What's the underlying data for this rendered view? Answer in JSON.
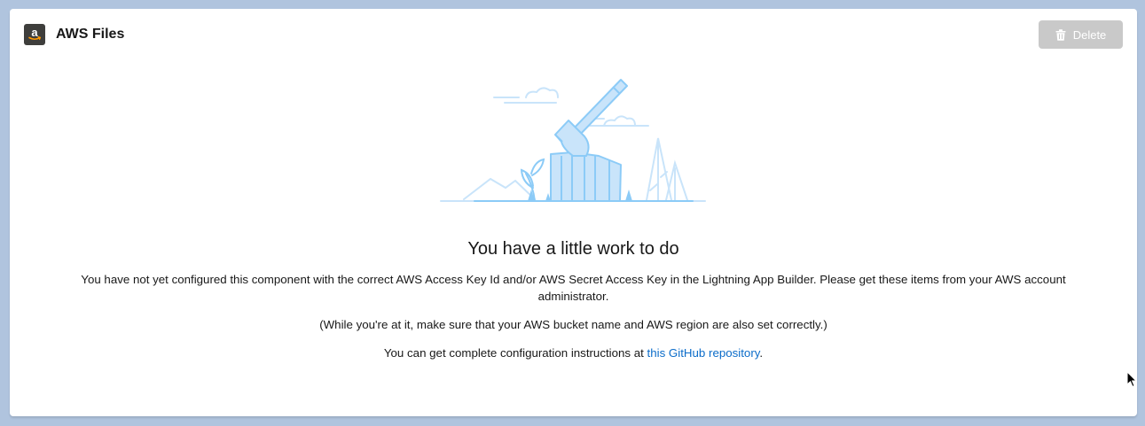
{
  "header": {
    "title": "AWS Files",
    "app_icon": "amazon-logo-icon",
    "delete_label": "Delete",
    "delete_icon": "trash-icon"
  },
  "empty_state": {
    "illustration": "axe-in-stump-illustration",
    "title": "You have a little work to do",
    "message1": "You have not yet configured this component with the correct AWS Access Key Id and/or AWS Secret Access Key in the Lightning App Builder. Please get these items from your AWS account administrator.",
    "message2": "(While you're at it, make sure that your AWS bucket name and AWS region are also set correctly.)",
    "message3_prefix": "You can get complete configuration instructions at ",
    "message3_link": "this GitHub repository",
    "message3_suffix": "."
  },
  "colors": {
    "background": "#b0c4de",
    "card": "#ffffff",
    "link": "#0b6cc9",
    "disabled_button": "#c9c9c9",
    "illustration_light": "#c9e4fa",
    "illustration_stroke": "#8ccbf7"
  }
}
